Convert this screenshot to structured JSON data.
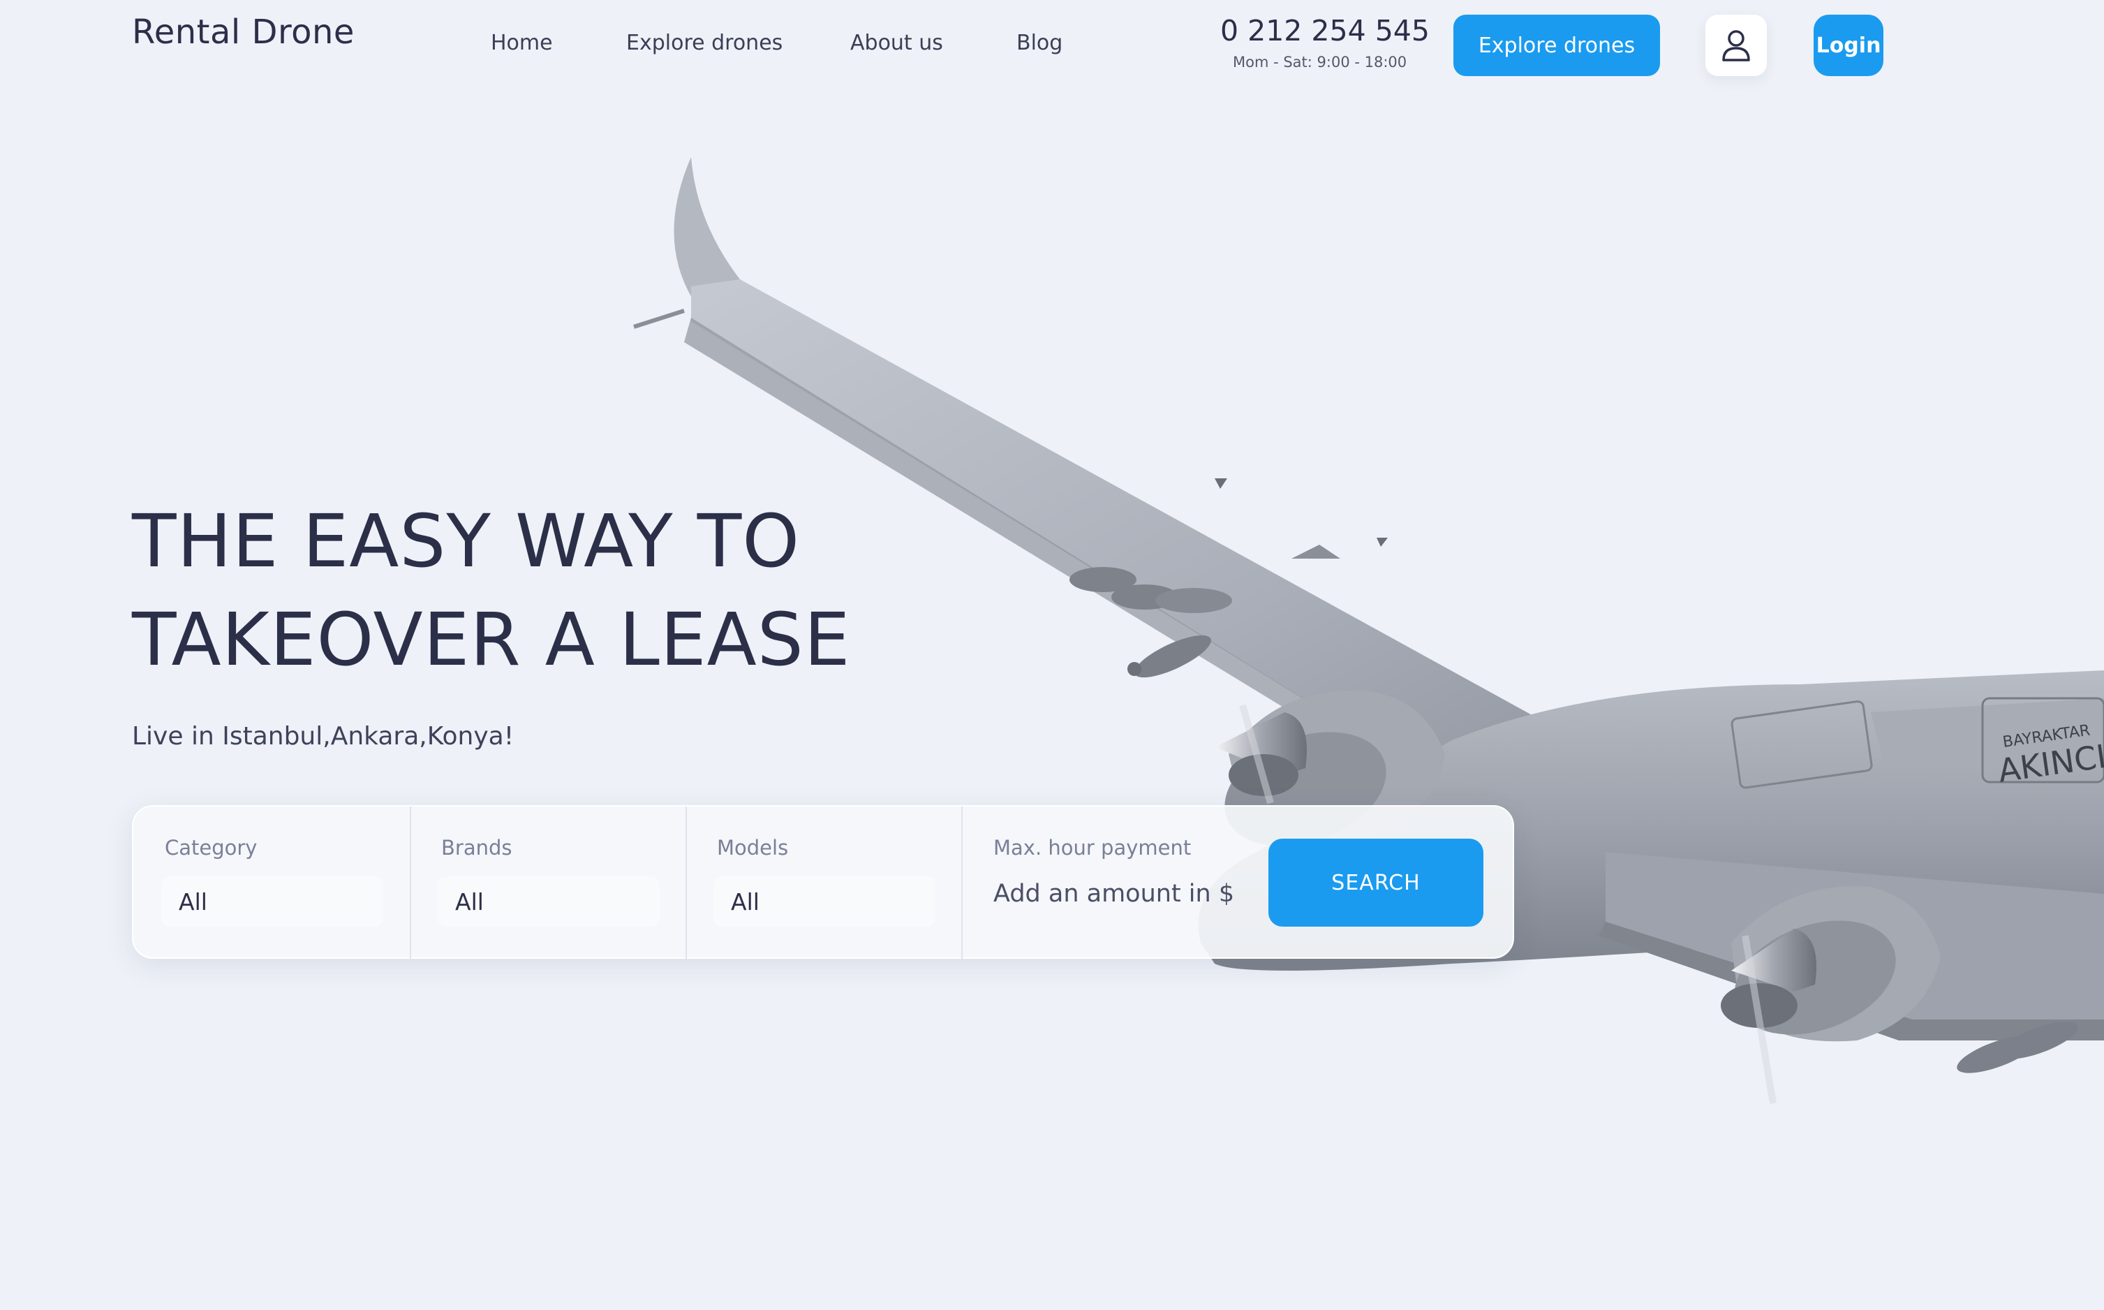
{
  "header": {
    "logo": "Rental Drone",
    "nav": [
      "Home",
      "Explore drones",
      "About us",
      "Blog"
    ],
    "phone": "0 212 254 545",
    "hours": "Mom - Sat: 9:00 - 18:00",
    "explore_button": "Explore drones",
    "user_icon": "user-icon",
    "login_button": "Login"
  },
  "hero": {
    "title_line1": "THE EASY WAY TO",
    "title_line2": "TAKEOVER A LEASE",
    "subtitle": "Live in Istanbul,Ankara,Konya!"
  },
  "search": {
    "category": {
      "label": "Category",
      "value": "All"
    },
    "brands": {
      "label": "Brands",
      "value": "All"
    },
    "models": {
      "label": "Models",
      "value": "All"
    },
    "max_payment": {
      "label": "Max. hour payment",
      "placeholder": "Add an amount in $"
    },
    "button": "SEARCH"
  },
  "drone_image": {
    "brand": "BAYRAKTAR",
    "model": "AKINCI"
  },
  "colors": {
    "accent": "#1a9bef",
    "background": "#eef1f7",
    "text": "#2c2f48"
  }
}
